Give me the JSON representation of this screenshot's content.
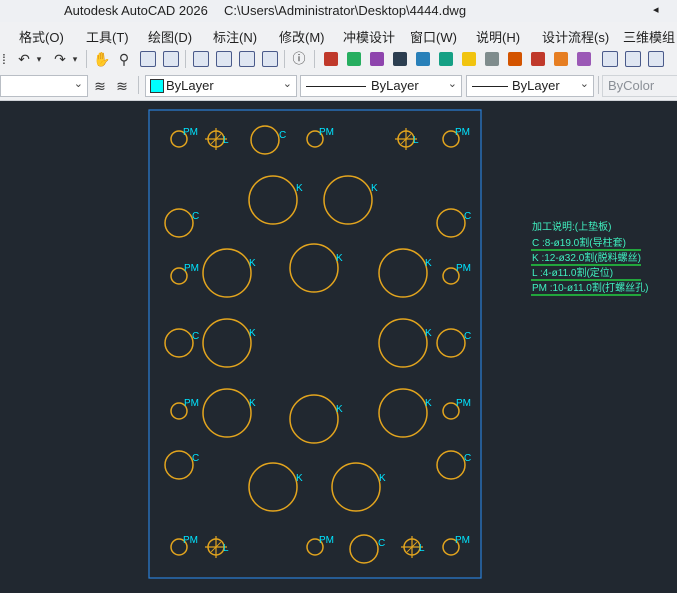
{
  "titlebar": {
    "app_title": "Autodesk AutoCAD 2026",
    "file_path": "C:\\Users\\Administrator\\Desktop\\4444.dwg",
    "nav_arrow": "◂"
  },
  "menubar": {
    "items": [
      "格式(O)",
      "工具(T)",
      "绘图(D)",
      "标注(N)",
      "修改(M)",
      "冲模设计",
      "窗口(W)",
      "说明(H)",
      "设计流程(s)",
      "三维模组"
    ]
  },
  "toolbar2": {
    "layer_value": "",
    "color_value": "ByLayer",
    "linetype_value": "ByLayer",
    "lineweight_value": "ByLayer",
    "plotstyle_value": "ByColor"
  },
  "drawing": {
    "hole_labels": {
      "C": "C",
      "K": "K",
      "L": "L",
      "PM": "PM"
    },
    "notes": {
      "title": "加工说明:(上垫板)",
      "lines": [
        "C   :8-ø19.0割(导柱套)",
        "K   :12-ø32.0割(脱料螺丝)",
        "L   :4-ø11.0割(定位)",
        "PM :10-ø11.0割(打螺丝孔)"
      ]
    }
  },
  "colors": {
    "canvas": "#212830",
    "hole": "#e3a51e",
    "label": "#00e5ff",
    "border": "#2a7fd6",
    "note": "#40f0c0",
    "note_underline": "#22d040"
  }
}
